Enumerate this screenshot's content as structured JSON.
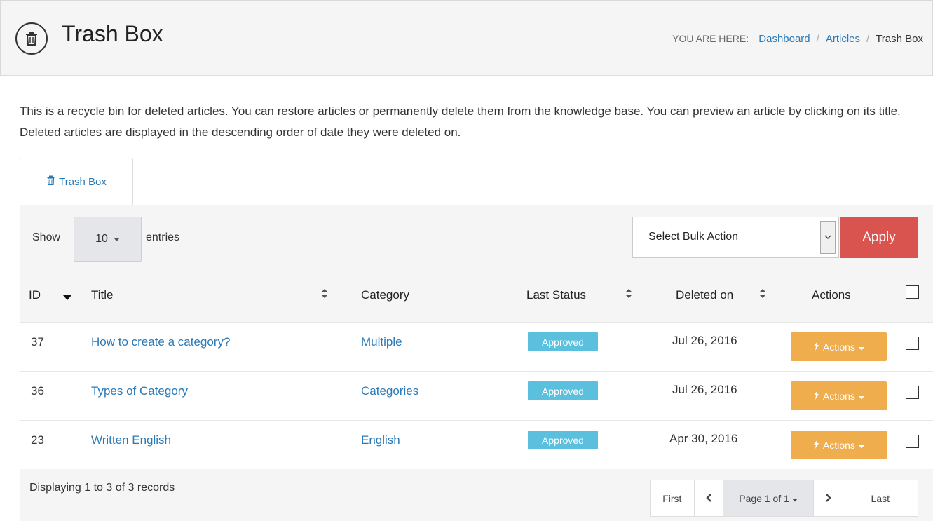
{
  "header": {
    "title": "Trash Box",
    "icon": "trash-icon",
    "breadcrumb_label": "YOU ARE HERE:",
    "breadcrumb": [
      "Dashboard",
      "Articles",
      "Trash Box"
    ]
  },
  "description": "This is a recycle bin for deleted articles. You can restore articles or permanently delete them from the knowledge base. You can preview an article by clicking on its title. Deleted articles are displayed in the descending order of date they were deleted on.",
  "tab": {
    "label": "Trash Box",
    "icon": "trash-icon"
  },
  "toolbar": {
    "show_label": "Show",
    "page_length": "10",
    "entries_label": "entries",
    "bulk_action_selected": "Select Bulk Action",
    "apply_label": "Apply"
  },
  "table": {
    "columns": [
      "ID",
      "Title",
      "Category",
      "Last Status",
      "Deleted on",
      "Actions"
    ],
    "rows": [
      {
        "id": "37",
        "title": "How to create a category?",
        "category": "Multiple",
        "status": "Approved",
        "deleted_on": "Jul 26, 2016",
        "action": "Actions"
      },
      {
        "id": "36",
        "title": "Types of Category",
        "category": "Categories",
        "status": "Approved",
        "deleted_on": "Jul 26, 2016",
        "action": "Actions"
      },
      {
        "id": "23",
        "title": "Written English",
        "category": "English",
        "status": "Approved",
        "deleted_on": "Apr 30, 2016",
        "action": "Actions"
      }
    ]
  },
  "footer": {
    "records_text": "Displaying 1 to 3 of 3 records",
    "pager": {
      "first": "First",
      "page": "Page 1 of 1",
      "last": "Last"
    }
  },
  "colors": {
    "link": "#2a7ab8",
    "apply": "#d9534f",
    "status_badge": "#5bc0de",
    "actions_button": "#f0ad4e"
  }
}
